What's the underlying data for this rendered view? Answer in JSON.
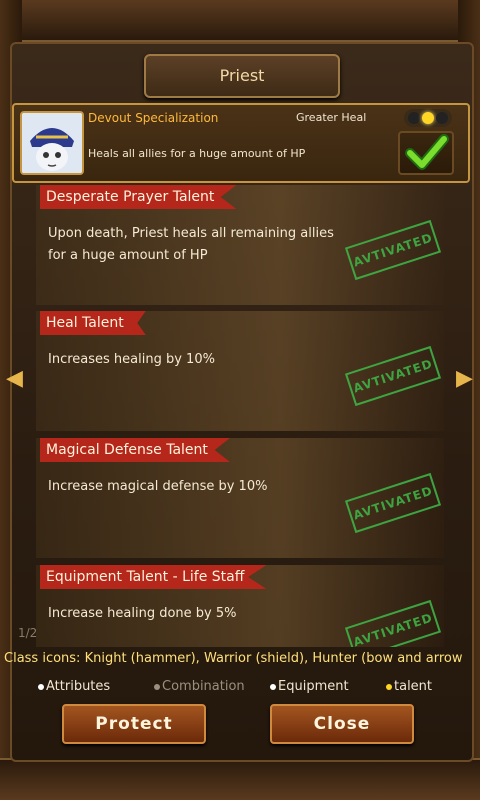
{
  "window": {
    "title": "Priest"
  },
  "specialization": {
    "name": "Devout Specialization",
    "skill": "Greater Heal",
    "description": "Heals all allies for a huge amount of HP",
    "level_dots": 3,
    "level_active": 1,
    "selected": true
  },
  "talents": [
    {
      "name": "Desperate Prayer Talent",
      "description": "Upon death, Priest heals all remaining allies for a huge amount of HP",
      "status": "AVTIVATED"
    },
    {
      "name": "Heal Talent",
      "description": "Increases healing by 10%",
      "status": "AVTIVATED"
    },
    {
      "name": "Magical Defense Talent",
      "description": "Increase magical defense by 10%",
      "status": "AVTIVATED"
    },
    {
      "name": "Equipment Talent - Life Staff",
      "description": "Increase healing done by 5%",
      "status": "AVTIVATED"
    }
  ],
  "caption": "Class icons: Knight (hammer), Warrior (shield), Hunter (bow and arrow",
  "pager": "1/2",
  "legend": {
    "attributes": "Attributes",
    "combination": "Combination",
    "equipment": "Equipment",
    "talent": "talent"
  },
  "buttons": {
    "protect": "Protect",
    "close": "Close"
  },
  "colors": {
    "ribbon": "#b5271b",
    "stamp": "#3fb246",
    "accent": "#ffb93a"
  }
}
